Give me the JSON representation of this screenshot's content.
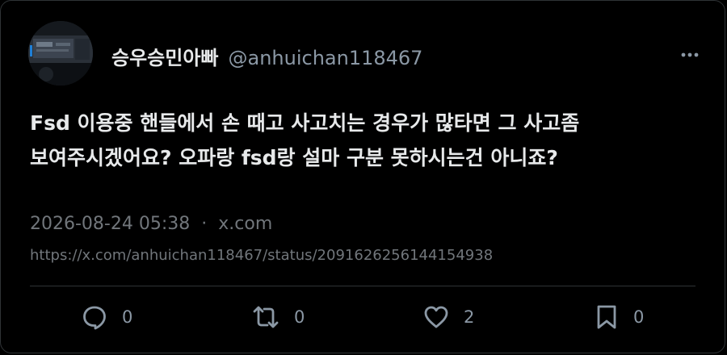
{
  "author": {
    "display_name": "승우승민아빠",
    "handle": "@anhuichan118467"
  },
  "tweet": {
    "lines": [
      "Fsd 이용중 핸들에서 손 때고 사고치는 경우가 많타면 그 사고좀",
      "보여주시겠어요? 오파랑 fsd랑 설마 구분 못하시는건 아니죠?"
    ]
  },
  "meta": {
    "timestamp": "2026-08-24 05:38",
    "separator": "·",
    "source": "x.com",
    "url": "https://x.com/anhuichan118467/status/2091626256144154938"
  },
  "actions": {
    "reply": {
      "icon": "reply-icon",
      "count": "0"
    },
    "retweet": {
      "icon": "retweet-icon",
      "count": "0"
    },
    "like": {
      "icon": "heart-icon",
      "count": "2"
    },
    "bookmark": {
      "icon": "bookmark-icon",
      "count": "0"
    }
  },
  "colors": {
    "background": "#000000",
    "text": "#e7e9ea",
    "muted": "#71767b",
    "border": "#2f3336"
  }
}
